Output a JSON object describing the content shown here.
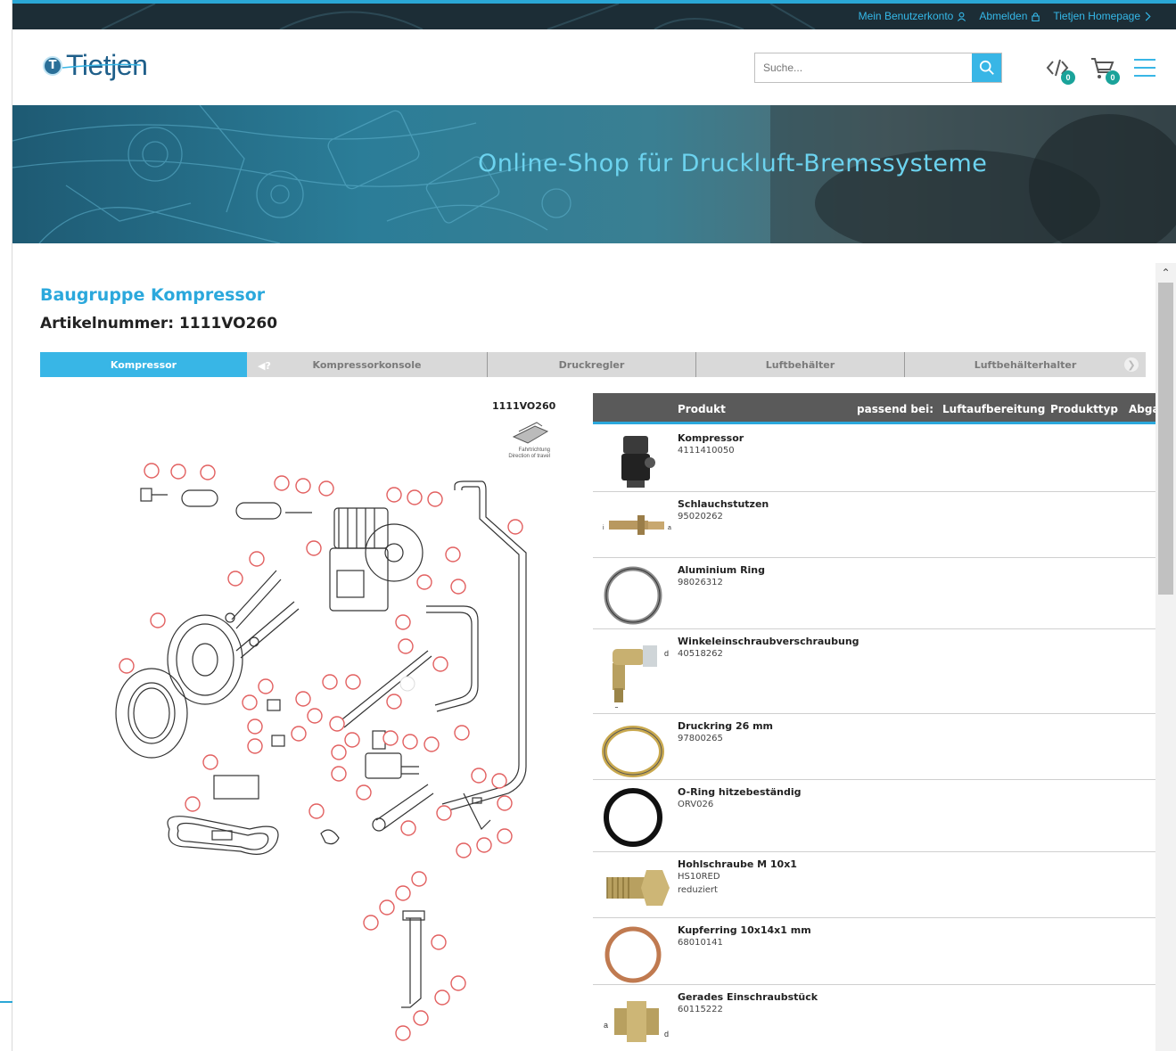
{
  "topbar": {
    "links": [
      {
        "label": "Mein Benutzerkonto",
        "icon": "user-icon"
      },
      {
        "label": "Abmelden",
        "icon": "lock-icon"
      },
      {
        "label": "Tietjen Homepage",
        "icon": "chevron-right-icon"
      }
    ]
  },
  "header": {
    "logo_text": "Tietjen",
    "logo_mark": "T",
    "search_placeholder": "Suche...",
    "compare_count": "0",
    "cart_count": "0"
  },
  "banner": {
    "title": "Online-Shop für Druckluft-Bremssysteme"
  },
  "content": {
    "title": "Baugruppe Kompressor",
    "subtitle": "Artikelnummer: 1111VO260"
  },
  "tabs": [
    {
      "label": "Kompressor",
      "active": true
    },
    {
      "label": "Kompressorkonsole",
      "active": false
    },
    {
      "label": "Druckregler",
      "active": false
    },
    {
      "label": "Luftbehälter",
      "active": false
    },
    {
      "label": "Luftbehälterhalter",
      "active": false
    }
  ],
  "diagram": {
    "code": "1111VO260",
    "direction_label_1": "Fahrtrichtung",
    "direction_label_2": "Direction of travel"
  },
  "product_table": {
    "headers": [
      "Produkt",
      "passend bei:",
      "Luftaufbereitung",
      "Produkttyp",
      "Abga"
    ],
    "rows": [
      {
        "name": "Kompressor",
        "number": "4111410050",
        "note": ""
      },
      {
        "name": "Schlauchstutzen",
        "number": "95020262",
        "note": ""
      },
      {
        "name": "Aluminium Ring",
        "number": "98026312",
        "note": ""
      },
      {
        "name": "Winkeleinschraubverschraubung",
        "number": "40518262",
        "note": ""
      },
      {
        "name": "Druckring 26 mm",
        "number": "97800265",
        "note": ""
      },
      {
        "name": "O-Ring hitzebeständig",
        "number": "ORV026",
        "note": ""
      },
      {
        "name": "Hohlschraube M 10x1",
        "number": "HS10RED",
        "note": "reduziert"
      },
      {
        "name": "Kupferring 10x14x1 mm",
        "number": "68010141",
        "note": ""
      },
      {
        "name": "Gerades Einschraubstück",
        "number": "60115222",
        "note": ""
      }
    ]
  },
  "colors": {
    "accent": "#38b6e6",
    "title_blue": "#2ba8dc",
    "table_head": "#5a5a5a",
    "badge": "#1aa39a"
  }
}
